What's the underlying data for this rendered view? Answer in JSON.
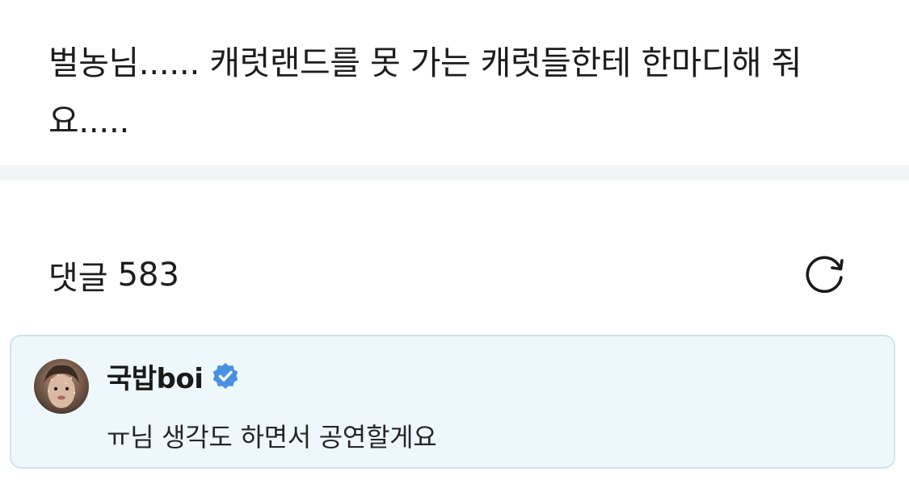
{
  "post": {
    "body": "벌농님...... 캐럿랜드를 못 가는 캐럿들한테 한마디해 줘요....."
  },
  "comments": {
    "label": "댓글",
    "count": "583",
    "refresh_icon": "refresh-icon"
  },
  "comment_list": [
    {
      "author": "국밥boi",
      "verified": true,
      "verified_color": "#4a90e2",
      "text": "ㅠ님 생각도 하면서 공연할게요"
    }
  ],
  "colors": {
    "divider": "#f3f4f6",
    "card_bg": "#eef8fc",
    "card_border": "#cfe3ec"
  }
}
